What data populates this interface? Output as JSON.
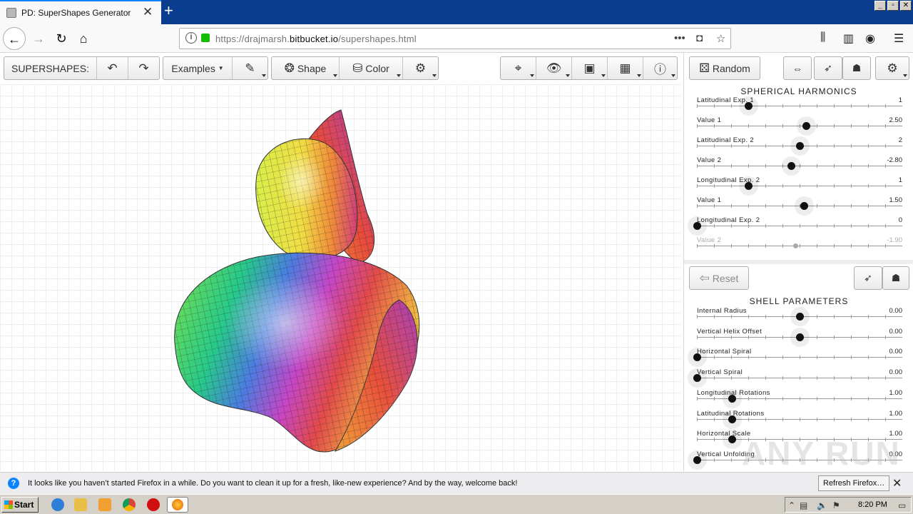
{
  "browser": {
    "tab_title": "PD: SuperShapes Generator",
    "tab_close": "✕",
    "new_tab": "+",
    "url_prefix": "https://drajmarsh.",
    "url_domain": "bitbucket.io",
    "url_path": "/supershapes.html",
    "page_actions": "•••",
    "window_controls": [
      "_",
      "▫",
      "✕"
    ]
  },
  "toolbar": {
    "app_label": "SUPERSHAPES:",
    "examples_label": "Examples",
    "shape_label": "Shape",
    "color_label": "Color",
    "random_label": "Random"
  },
  "spherical_harmonics": {
    "title": "SPHERICAL HARMONICS",
    "sliders": [
      {
        "label": "Latitudinal Exp. 1",
        "value": "1",
        "level": 0.25,
        "enabled": true
      },
      {
        "label": "Value 1",
        "value": "2.50",
        "level": 0.53,
        "enabled": true
      },
      {
        "label": "Latitudinal Exp. 2",
        "value": "2",
        "level": 0.5,
        "enabled": true
      },
      {
        "label": "Value 2",
        "value": "-2.80",
        "level": 0.46,
        "enabled": true
      },
      {
        "label": "Longitudinal Exp. 2",
        "value": "1",
        "level": 0.25,
        "enabled": true
      },
      {
        "label": "Value 1",
        "value": "1.50",
        "level": 0.52,
        "enabled": true
      },
      {
        "label": "Longitudinal Exp. 2",
        "value": "0",
        "level": 0.0,
        "enabled": true
      },
      {
        "label": "Value 2",
        "value": "-1.90",
        "level": 0.48,
        "enabled": false
      }
    ]
  },
  "shell_parameters": {
    "title": "SHELL PARAMETERS",
    "reset_label": "Reset",
    "sliders": [
      {
        "label": "Internal Radius",
        "value": "0.00",
        "level": 0.5
      },
      {
        "label": "Vertical Helix Offset",
        "value": "0.00",
        "level": 0.5
      },
      {
        "label": "Horizontal Spiral",
        "value": "0.00",
        "level": 0.0
      },
      {
        "label": "Vertical Spiral",
        "value": "0.00",
        "level": 0.0
      },
      {
        "label": "Longitudinal Rotations",
        "value": "1.00",
        "level": 0.17
      },
      {
        "label": "Latitudinal Rotations",
        "value": "1.00",
        "level": 0.17
      },
      {
        "label": "Horizontal Scale",
        "value": "1.00",
        "level": 0.17
      },
      {
        "label": "Vertical Unfolding",
        "value": "0.00",
        "level": 0.0
      }
    ]
  },
  "notification": {
    "message": "It looks like you haven’t started Firefox in a while. Do you want to clean it up for a fresh, like-new experience? And by the way, welcome back!",
    "button_label": "Refresh Firefox…",
    "close": "✕"
  },
  "taskbar": {
    "start_label": "Start",
    "clock": "8:20 PM"
  },
  "watermark": "ANY RUN",
  "colors": {
    "accent": "#5588d0",
    "firefox_tabbar": "#0b3d8f"
  }
}
